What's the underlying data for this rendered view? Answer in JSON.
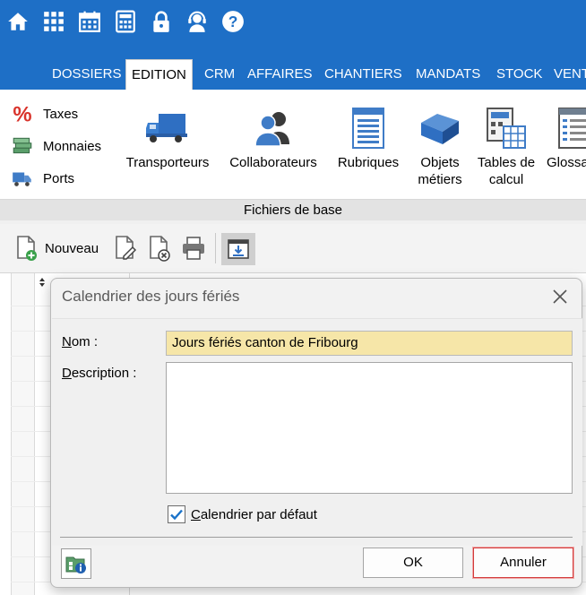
{
  "menu_tabs": [
    {
      "label": "DOSSIERS"
    },
    {
      "label": "EDITION"
    },
    {
      "label": "CRM"
    },
    {
      "label": "AFFAIRES"
    },
    {
      "label": "CHANTIERS"
    },
    {
      "label": "MANDATS"
    },
    {
      "label": "STOCK"
    },
    {
      "label": "VENT"
    }
  ],
  "quick_icons": [
    "home-icon",
    "grid-apps-icon",
    "calendar-icon",
    "calculator-icon",
    "lock-icon",
    "support-agent-icon",
    "help-icon"
  ],
  "ribbon": {
    "small_items": [
      {
        "label": "Taxes",
        "icon": "percent-icon"
      },
      {
        "label": "Monnaies",
        "icon": "money-stack-icon"
      },
      {
        "label": "Ports",
        "icon": "port-truck-icon"
      }
    ],
    "big_buttons": [
      {
        "line1": "Transporteurs",
        "line2": "",
        "icon": "truck-icon"
      },
      {
        "line1": "Collaborateurs",
        "line2": "",
        "icon": "users-icon"
      },
      {
        "line1": "Rubriques",
        "line2": "",
        "icon": "list-document-icon"
      },
      {
        "line1": "Objets",
        "line2": "métiers",
        "icon": "box-icon"
      },
      {
        "line1": "Tables de",
        "line2": "calcul",
        "icon": "calc-table-icon"
      },
      {
        "line1": "Glossa",
        "line2": "",
        "icon": "glossary-icon"
      }
    ],
    "group_label": "Fichiers de base"
  },
  "toolbar": {
    "new_label": "Nouveau"
  },
  "dialog": {
    "title": "Calendrier des jours fériés",
    "nom_label_first": "N",
    "nom_label_rest": "om :",
    "nom_value": "Jours fériés canton de Fribourg",
    "desc_label_first": "D",
    "desc_label_rest": "escription :",
    "desc_value": "",
    "default_first": "C",
    "default_rest": "alendrier par défaut",
    "default_checked": true,
    "ok_label": "OK",
    "cancel_label": "Annuler"
  },
  "colors": {
    "menu_blue": "#1e6fc6",
    "input_yellow": "#f6e6a8",
    "check_blue": "#1a73c9",
    "cancel_red": "#d33c3c"
  }
}
